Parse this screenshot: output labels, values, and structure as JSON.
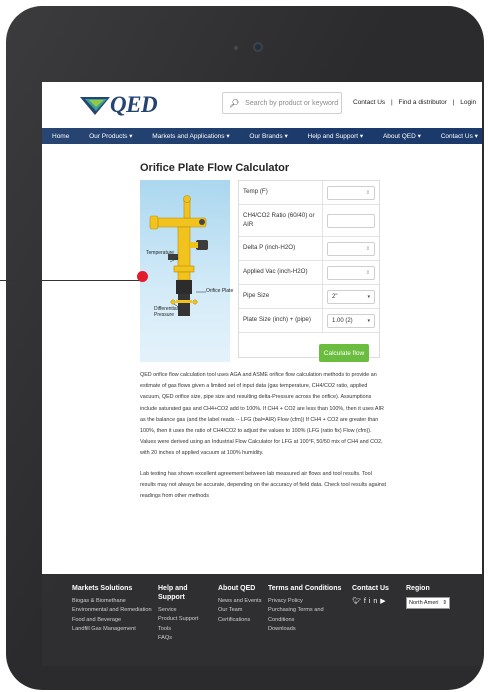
{
  "header": {
    "logo_text": "QED",
    "search_placeholder": "Search by product or keyword",
    "links": {
      "contact": "Contact Us",
      "sep1": "|",
      "distributor": "Find a distributor",
      "sep2": "|",
      "login": "Login"
    }
  },
  "nav": [
    {
      "label": "Home"
    },
    {
      "label": "Our Products ▾"
    },
    {
      "label": "Markets and Applications ▾"
    },
    {
      "label": "Our Brands ▾"
    },
    {
      "label": "Help and Support ▾"
    },
    {
      "label": "About QED ▾"
    },
    {
      "label": "Contact Us ▾"
    }
  ],
  "page": {
    "title": "Orifice Plate Flow Calculator",
    "image_labels": {
      "temperature": "Temperature",
      "orifice": "Orifice Plate",
      "differential": "Differential\nPressure"
    }
  },
  "calculator": {
    "temp_label": "Temp (F)",
    "ratio_label": "CH4/CO2 Ratio (60/40) or AIR",
    "delta_label": "Delta P (inch-H2O)",
    "vac_label": "Applied Vac (inch-H2O)",
    "pipe_label": "Pipe Size",
    "pipe_value": "2\"",
    "plate_label": "Plate Size (inch) + (pipe)",
    "plate_value": "1.00 (2)",
    "button": "Calculate flow"
  },
  "description": {
    "p1": "QED orifice flow calculation tool uses AGA and ASME orifice flow calculation methods to provide an estimate of gas flows given a limited set of input data (gas temperature, CH4/CO2 ratio, applied vacuum, QED orifice size, pipe size and resulting delta-Pressure across the orifice). Assumptions include saturated gas and CH4+CO2 add to 100%. If CH4 + CO2 are less than 100%, then it uses AIR as the balance gas (and the label reads -- LFG (bal=AIR) Flow (cfm)) If CH4 + CO2 are greater than 100%, then it uses the ratio of CH4/CO2 to adjust the values to 100% (LFG (ratio fix) Flow (cfm)). Values were derived using an Industrial Flow Calculator for LFG at 100°F, 50/50 mix of CH4 and CO2, with 20 inches of applied vacuum at 100% humidity.",
    "p2": "Lab testing has shown excellent agreement between lab measured air flows and tool results. Tool results may not always be accurate, depending on the accuracy of field data. Check tool results against readings from other methods"
  },
  "footer": {
    "markets": {
      "head": "Markets Solutions",
      "l1": "Biogas & Biomethane",
      "l2": "Environmental and Remediation",
      "l3": "Food and Beverage",
      "l4": "Landfill Gas Management"
    },
    "help": {
      "head": "Help and Support",
      "l1": "Service",
      "l2": "Product Support",
      "l3": "Tools",
      "l4": "FAQs"
    },
    "about": {
      "head": "About QED",
      "l1": "News and Events",
      "l2": "Our Team",
      "l3": "Certifications"
    },
    "terms": {
      "head": "Terms and Conditions",
      "l1": "Privacy Policy",
      "l2": "Purchasing Terms and Conditions",
      "l3": "Downloads"
    },
    "contact": {
      "head": "Contact Us"
    },
    "region": {
      "head": "Region",
      "value": "North Ameri"
    }
  },
  "colors": {
    "nav": "#1b3a6b",
    "button": "#6bbd3f",
    "footer": "#2f2f31",
    "marker": "#e21b2d"
  }
}
